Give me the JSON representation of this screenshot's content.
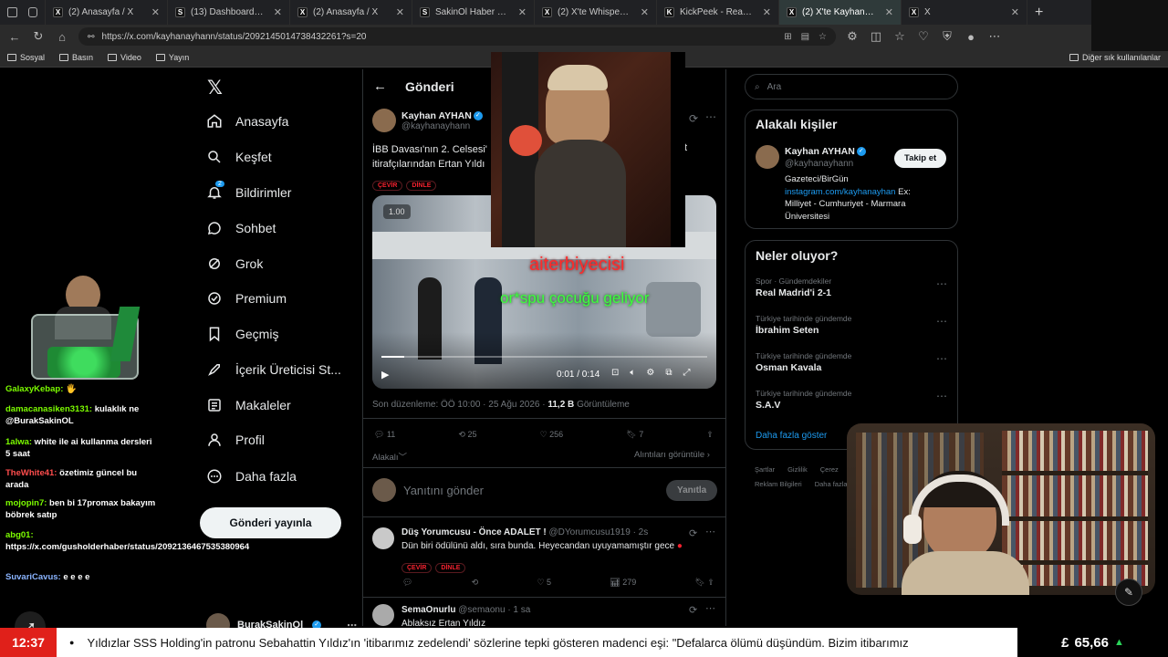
{
  "browser": {
    "tabs": [
      {
        "title": "(2) Anasayfa / X",
        "icon": "X",
        "active": false
      },
      {
        "title": "(13) Dashboard / Streamlabs",
        "icon": "S",
        "active": false
      },
      {
        "title": "(2) Anasayfa / X",
        "icon": "X",
        "active": false
      },
      {
        "title": "SakinOl Haber Merkezi",
        "icon": "S",
        "active": false
      },
      {
        "title": "(2) X'te Whisper: \"Saldırının",
        "icon": "X",
        "active": false
      },
      {
        "title": "KickPeek - Real-time URL C",
        "icon": "K",
        "active": false
      },
      {
        "title": "(2) X'te Kayhan AYHAN:",
        "icon": "X",
        "active": true
      },
      {
        "title": "X",
        "icon": "X",
        "active": false
      }
    ],
    "url": "https://x.com/kayhanayhann/status/2092145014738432261?s=20",
    "bookmarks": [
      "Sosyal",
      "Basın",
      "Video",
      "Yayın"
    ],
    "other_bookmarks": "Diğer sık kullanılanlar"
  },
  "nav": {
    "items": [
      {
        "label": "Anasayfa",
        "icon": "home-icon"
      },
      {
        "label": "Keşfet",
        "icon": "search-icon"
      },
      {
        "label": "Bildirimler",
        "icon": "bell-icon",
        "badge": "2"
      },
      {
        "label": "Sohbet",
        "icon": "chat-icon"
      },
      {
        "label": "Grok",
        "icon": "grok-icon"
      },
      {
        "label": "Premium",
        "icon": "premium-icon"
      },
      {
        "label": "Geçmiş",
        "icon": "bookmark-icon"
      },
      {
        "label": "İçerik Üreticisi St...",
        "icon": "rocket-icon"
      },
      {
        "label": "Makaleler",
        "icon": "article-icon"
      },
      {
        "label": "Profil",
        "icon": "person-icon"
      },
      {
        "label": "Daha fazla",
        "icon": "more-icon"
      }
    ],
    "post_button": "Gönderi yayınla",
    "account_name": "BurakSakinOl"
  },
  "main": {
    "header_title": "Gönderi",
    "author_name": "Kayhan AYHAN",
    "author_handle": "@kayhanayhann",
    "text_start": "İBB Davası'nın 2. Celsesi'",
    "text_end": "t",
    "text_line2": "itirafçılarından Ertan Yıldı",
    "pill_translate": "ÇEVİR",
    "pill_listen": "DİNLE",
    "video_speed": "1.00",
    "video_time": "0:01 / 0:14",
    "video_progress": 0.07,
    "edited_line": "Son düzenleme: ÖÖ 10:00 · 25 Ağu 2026 ·",
    "views_count": "11,2 B",
    "views_label": "Görüntüleme",
    "replies": "11",
    "reposts": "25",
    "likes": "256",
    "bookmarks": "7",
    "related_label": "Alakalı",
    "quotes_label": "Alıntıları görüntüle ›",
    "reply_placeholder": "Yanıtını gönder",
    "reply_button": "Yanıtla",
    "replies_list": [
      {
        "name": "Düş Yorumcusu - Önce ADALET !",
        "handle": "@DYorumcusu1919",
        "time": "· 2s",
        "text": "Dün biri ödülünü aldı, sıra bunda. Heyecandan uyuyamamıştır gece",
        "replies": "",
        "reposts": "",
        "likes": "5",
        "views": "279"
      },
      {
        "name": "SemaOnurlu",
        "handle": "@semaonu",
        "time": "· 1 sa",
        "text": "Ablaksız Ertan Yıldız"
      }
    ]
  },
  "right": {
    "search_placeholder": "Ara",
    "related_title": "Alakalı kişiler",
    "person_name": "Kayhan AYHAN",
    "person_handle": "@kayhanayhann",
    "follow_button": "Takip et",
    "bio_line1": "Gazeteci/BirGün",
    "bio_link": "instagram.com/kayhanayhan",
    "bio_rest1": " Ex:",
    "bio_line3": "Milliyet - Cumhuriyet - Marmara",
    "bio_line4": "Üniversitesi",
    "trends_title": "Neler oluyor?",
    "trends": [
      {
        "context": "Spor · Gündemdekiler",
        "name": "Real Madrid'i 2-1"
      },
      {
        "context": "Türkiye tarihinde gündemde",
        "name": "İbrahim Seten"
      },
      {
        "context": "Türkiye tarihinde gündemde",
        "name": "Osman Kavala"
      },
      {
        "context": "Türkiye tarihinde gündemde",
        "name": "S.A.V"
      }
    ],
    "show_more": "Daha fazla göster",
    "footer_1": "Şartlar",
    "footer_2": "Gizlilik",
    "footer_3": "Çerez",
    "footer_4": "Reklam Bilgileri",
    "footer_5": "Daha fazla"
  },
  "overlay": {
    "alert_red": "aiterbiyecisi",
    "alert_green": "or*spu çocuğu geliyor",
    "chat": [
      {
        "user": "GalaxyKebap:",
        "msg": " 🖐",
        "color": "#7CFC00"
      },
      {
        "user": "damacanasiken3131:",
        "msg": " kulaklık ne @BurakSakinOL",
        "color": "#7CFC00"
      },
      {
        "user": "1alwa:",
        "msg": " white ile ai kullanma dersleri 5 saat",
        "color": "#7CFC00"
      },
      {
        "user": "TheWhite41:",
        "msg": " özetimiz güncel bu arada",
        "color": "#ff4d4d"
      },
      {
        "user": "mojopin7:",
        "msg": " ben bi 17promax bakayım böbrek satıp",
        "color": "#7CFC00"
      },
      {
        "user": "abg01:",
        "msg": " https://x.com/gusholderhaber/status/2092136467535380964",
        "color": "#7CFC00"
      },
      {
        "user": "SuvariCavus:",
        "msg": " e e e e",
        "color": "#8ab4ff"
      }
    ]
  },
  "ticker": {
    "clock": "12:37",
    "text": "Yıldızlar SSS Holding'in patronu Sebahattin Yıldız'ın 'itibarımız zedelendi' sözlerine tepki gösteren madenci eşi: \"Defalarca ölümü düşündüm. Bizim itibarımız",
    "price": "65,66",
    "currency": "£"
  }
}
